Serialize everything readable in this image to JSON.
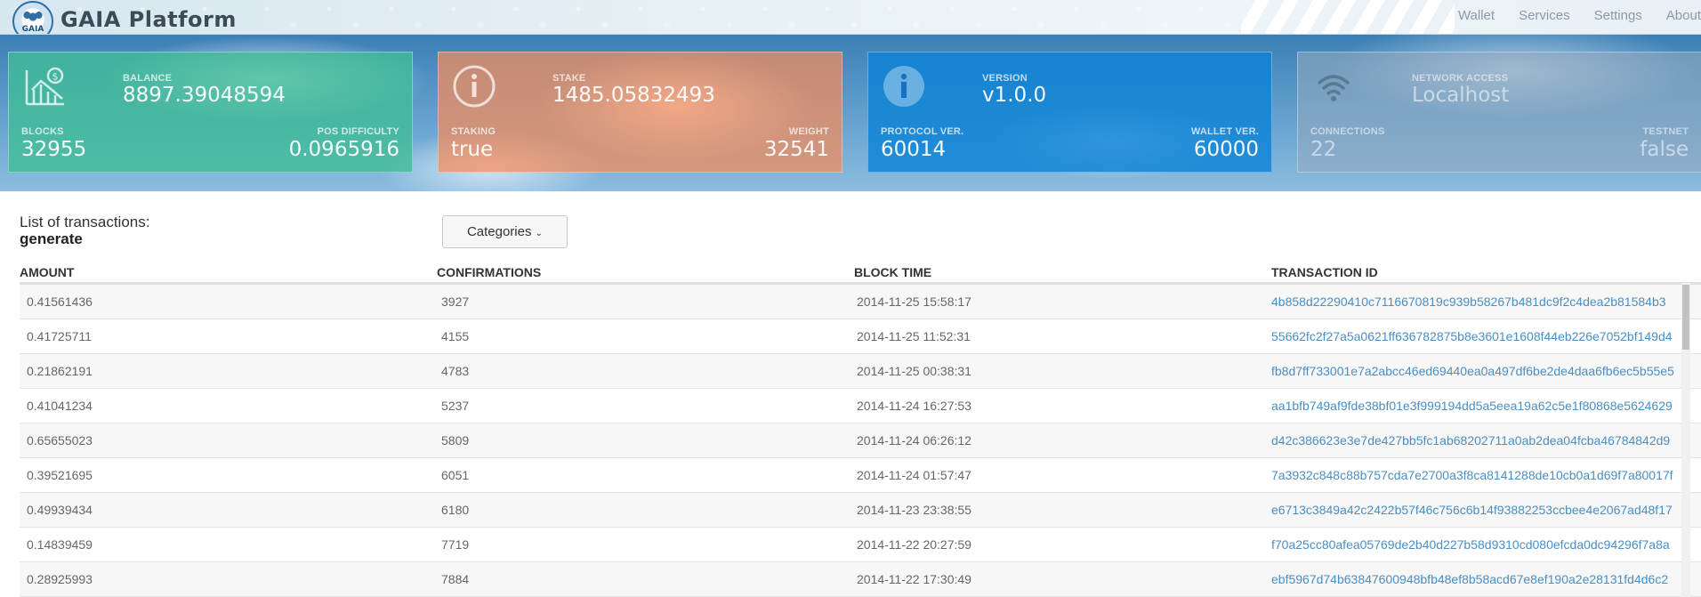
{
  "app": {
    "brand": "GAIA Platform",
    "logo_text": "GAIA"
  },
  "nav": {
    "items": [
      {
        "label": "Wallet"
      },
      {
        "label": "Services"
      },
      {
        "label": "Settings"
      },
      {
        "label": "About"
      }
    ]
  },
  "cards": {
    "balance": {
      "top_label": "BALANCE",
      "top_value": "8897.39048594",
      "bl_label": "BLOCKS",
      "bl_value": "32955",
      "br_label": "POS DIFFICULTY",
      "br_value": "0.0965916",
      "icon": "chart-dollar-icon"
    },
    "stake": {
      "top_label": "STAKE",
      "top_value": "1485.05832493",
      "bl_label": "STAKING",
      "bl_value": "true",
      "br_label": "WEIGHT",
      "br_value": "32541",
      "icon": "info-icon"
    },
    "version": {
      "top_label": "VERSION",
      "top_value": "v1.0.0",
      "bl_label": "PROTOCOL VER.",
      "bl_value": "60014",
      "br_label": "WALLET VER.",
      "br_value": "60000",
      "icon": "info-icon"
    },
    "network": {
      "top_label": "NETWORK ACCESS",
      "top_value": "Localhost",
      "bl_label": "CONNECTIONS",
      "bl_value": "22",
      "br_label": "TESTNET",
      "br_value": "false",
      "icon": "wifi-icon"
    }
  },
  "list": {
    "title": "List of transactions:",
    "filter": "generate",
    "categories_label": "Categories"
  },
  "table": {
    "headers": [
      "AMOUNT",
      "CONFIRMATIONS",
      "BLOCK TIME",
      "TRANSACTION ID"
    ],
    "rows": [
      {
        "amount": "0.41561436",
        "confirmations": "3927",
        "time": "2014-11-25 15:58:17",
        "txid": "4b858d22290410c7116670819c939b58267b481dc9f2c4dea2b81584b3"
      },
      {
        "amount": "0.41725711",
        "confirmations": "4155",
        "time": "2014-11-25 11:52:31",
        "txid": "55662fc2f27a5a0621ff636782875b8e3601e1608f44eb226e7052bf149d4"
      },
      {
        "amount": "0.21862191",
        "confirmations": "4783",
        "time": "2014-11-25 00:38:31",
        "txid": "fb8d7ff733001e7a2abcc46ed69440ea0a497df6be2de4daa6fb6ec5b55e5"
      },
      {
        "amount": "0.41041234",
        "confirmations": "5237",
        "time": "2014-11-24 16:27:53",
        "txid": "aa1bfb749af9fde38bf01e3f999194dd5a5eea19a62c5e1f80868e5624629"
      },
      {
        "amount": "0.65655023",
        "confirmations": "5809",
        "time": "2014-11-24 06:26:12",
        "txid": "d42c386623e3e7de427bb5fc1ab68202711a0ab2dea04fcba46784842d9"
      },
      {
        "amount": "0.39521695",
        "confirmations": "6051",
        "time": "2014-11-24 01:57:47",
        "txid": "7a3932c848c88b757cda7e2700a3f8ca8141288de10cb0a1d69f7a80017f"
      },
      {
        "amount": "0.49939434",
        "confirmations": "6180",
        "time": "2014-11-23 23:38:55",
        "txid": "e6713c3849a42c2422b57f46c756c6b14f93882253ccbee4e2067ad48f17"
      },
      {
        "amount": "0.14839459",
        "confirmations": "7719",
        "time": "2014-11-22 20:27:59",
        "txid": "f70a25cc80afea05769de2b40d227b58d9310cd080efcda0dc94296f7a8a"
      },
      {
        "amount": "0.28925993",
        "confirmations": "7884",
        "time": "2014-11-22 17:30:49",
        "txid": "ebf5967d74b63847600948bfb48ef8b58acd67e8ef190a2e28131fd4d6c2"
      }
    ]
  }
}
